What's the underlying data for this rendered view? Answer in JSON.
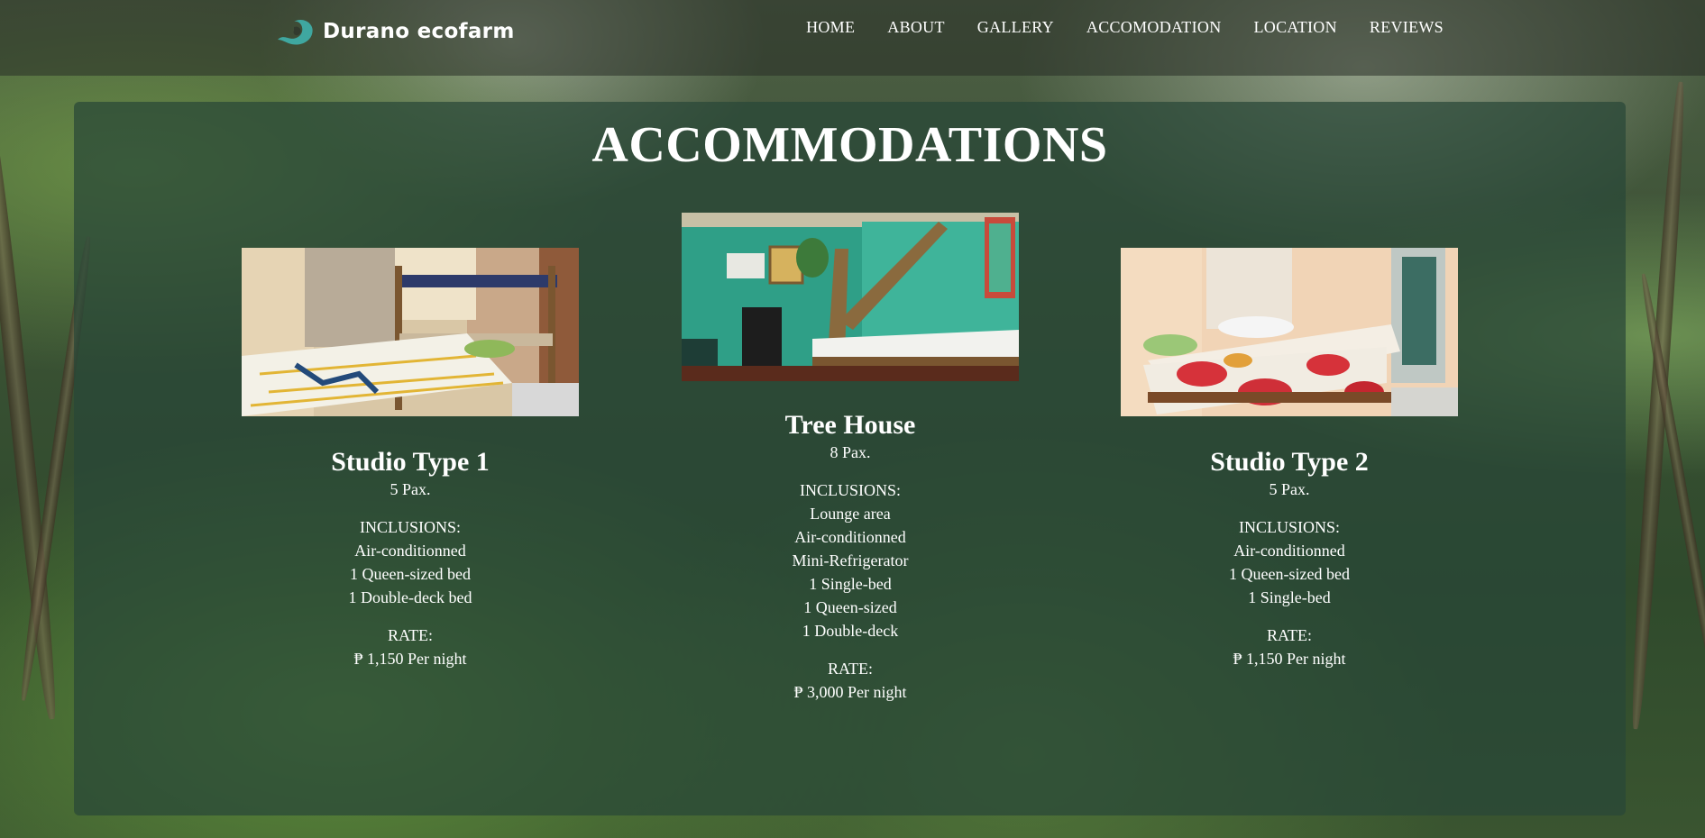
{
  "brand": {
    "name": "Durano ecofarm",
    "accent": "#3fa7a0"
  },
  "nav": [
    "HOME",
    "ABOUT",
    "GALLERY",
    "ACCOMODATION",
    "LOCATION",
    "REVIEWS"
  ],
  "section_title": "ACCOMMODATIONS",
  "rooms": [
    {
      "name": "Studio Type 1",
      "pax": "5 Pax.",
      "inclusions_label": "INCLUSIONS:",
      "inclusions": [
        "Air-conditionned",
        "1 Queen-sized bed",
        "1 Double-deck bed"
      ],
      "rate_label": "RATE:",
      "rate": "₱ 1,150 Per night"
    },
    {
      "name": "Tree House",
      "pax": "8 Pax.",
      "inclusions_label": "INCLUSIONS:",
      "inclusions": [
        "Lounge area",
        "Air-conditionned",
        "Mini-Refrigerator",
        "1 Single-bed",
        "1 Queen-sized",
        "1 Double-deck"
      ],
      "rate_label": "RATE:",
      "rate": "₱ 3,000 Per night"
    },
    {
      "name": "Studio Type 2",
      "pax": "5 Pax.",
      "inclusions_label": "INCLUSIONS:",
      "inclusions": [
        "Air-conditionned",
        "1 Queen-sized bed",
        "1 Single-bed"
      ],
      "rate_label": "RATE:",
      "rate": "₱ 1,150 Per night"
    }
  ],
  "colors": {
    "panel": "rgba(40,70,55,0.72)",
    "text": "#ffffff"
  }
}
